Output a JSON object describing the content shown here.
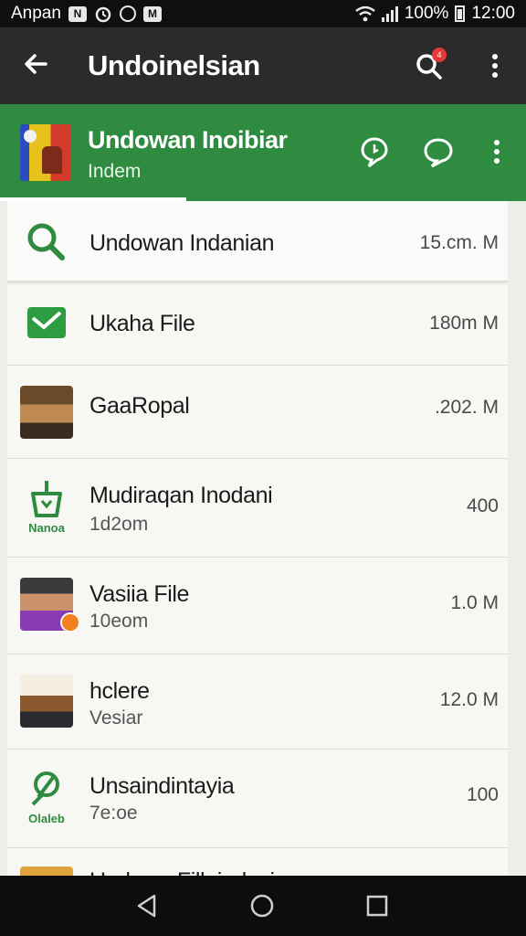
{
  "status_bar": {
    "carrier": "Anpan",
    "battery": "100%",
    "time": "12:00",
    "icons": [
      "notification-n-icon",
      "alarm-icon",
      "chat-icon",
      "mail-icon",
      "wifi-icon",
      "signal-icon",
      "battery-icon"
    ]
  },
  "app_bar": {
    "title": "Undoinelsian",
    "notification_count": "4",
    "icons": [
      "back-arrow-icon",
      "search-icon",
      "more-vert-icon"
    ]
  },
  "chat_header": {
    "name": "Undowan Inoibiar",
    "subtitle": "Indem",
    "icons": [
      "pin-icon",
      "chat-bubble-icon",
      "more-vert-icon"
    ]
  },
  "files": [
    {
      "title": "Undowan Indanian",
      "subtitle": "",
      "size": "15.cm. M",
      "thumb": "search-icon"
    },
    {
      "title": "Ukaha File",
      "subtitle": "",
      "size": "180m M",
      "thumb": "mail-icon"
    },
    {
      "title": "GaaRopal",
      "subtitle": "",
      "size": ".202. M",
      "thumb": "photo"
    },
    {
      "title": "Mudiraqan Inodani",
      "subtitle": "1d2om",
      "size": "400",
      "thumb": "basket-icon",
      "caption": "Nanoa"
    },
    {
      "title": "Vasiia File",
      "subtitle": "10eom",
      "size": "1.0 M",
      "thumb": "photo"
    },
    {
      "title": "hclere",
      "subtitle": "Vesiar",
      "size": "12.0 M",
      "thumb": "photo"
    },
    {
      "title": "Unsaindintayia",
      "subtitle": "7e:oe",
      "size": "100",
      "thumb": "leaf-icon",
      "caption": "Olaleb"
    },
    {
      "title": "Undowa Filleindosin",
      "subtitle": "",
      "size": "",
      "thumb": "photo"
    }
  ],
  "colors": {
    "accent_green": "#2e8b3f",
    "app_bar": "#2b2b2b",
    "badge_red": "#e53935",
    "badge_orange": "#f2811d"
  }
}
